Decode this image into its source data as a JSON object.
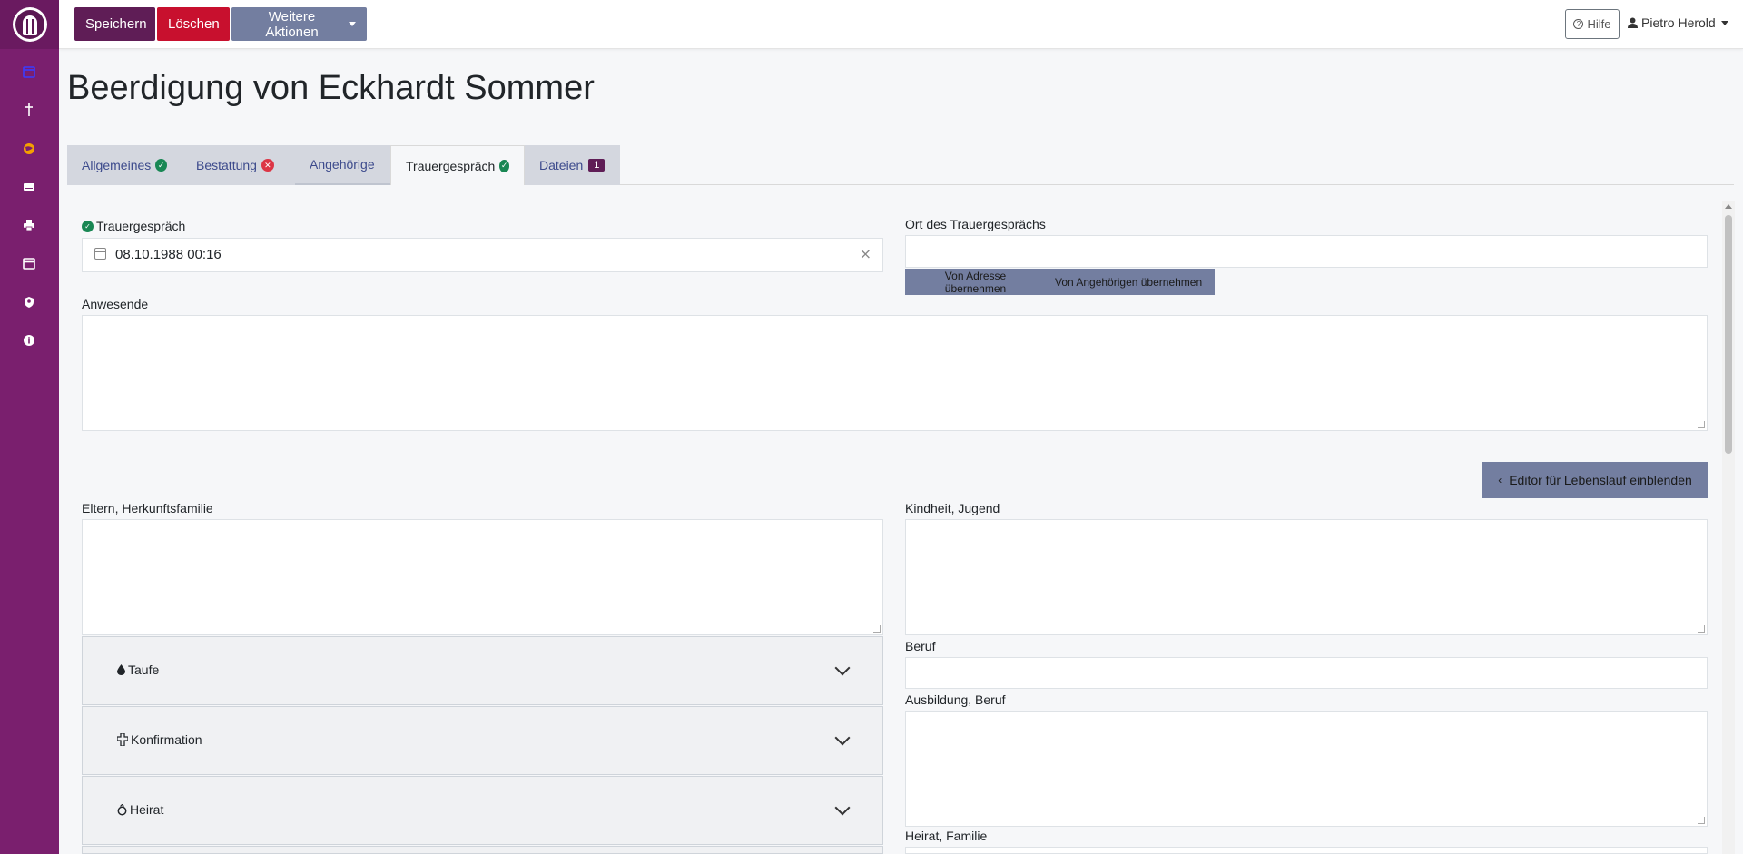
{
  "toolbar": {
    "save_label": "Speichern",
    "delete_label": "Löschen",
    "more_actions_label": "Weitere Aktionen",
    "help_label": "Hilfe",
    "user_name": "Pietro Herold"
  },
  "page": {
    "title": "Beerdigung von Eckhardt Sommer"
  },
  "tabs": [
    {
      "label": "Allgemeines",
      "status": "ok"
    },
    {
      "label": "Bestattung",
      "status": "error"
    },
    {
      "label": "Angehörige",
      "status": "none"
    },
    {
      "label": "Trauergespräch",
      "status": "ok"
    },
    {
      "label": "Dateien",
      "badge": "1"
    }
  ],
  "form": {
    "trauergespraech_label": "Trauergespräch",
    "trauergespraech_value": "08.10.1988 00:16",
    "ort_label": "Ort des Trauergesprächs",
    "ort_value": "",
    "von_adresse_label": "Von Adresse übernehmen",
    "von_angehoerigen_label": "Von Angehörigen übernehmen",
    "anwesende_label": "Anwesende",
    "anwesende_value": "",
    "editor_button_label": "Editor für Lebenslauf einblenden",
    "eltern_label": "Eltern, Herkunftsfamilie",
    "kindheit_label": "Kindheit, Jugend",
    "beruf_label": "Beruf",
    "ausbildung_label": "Ausbildung, Beruf",
    "heirat_familie_label": "Heirat, Familie"
  },
  "accordions": [
    {
      "label": "Taufe",
      "icon": "drop-icon"
    },
    {
      "label": "Konfirmation",
      "icon": "cross-icon"
    },
    {
      "label": "Heirat",
      "icon": "ring-icon"
    }
  ],
  "colors": {
    "sidebar": "#7a1f6e",
    "primary": "#5f1d56",
    "danger": "#c8102e",
    "secondary": "#737ea0",
    "success": "#198754"
  }
}
